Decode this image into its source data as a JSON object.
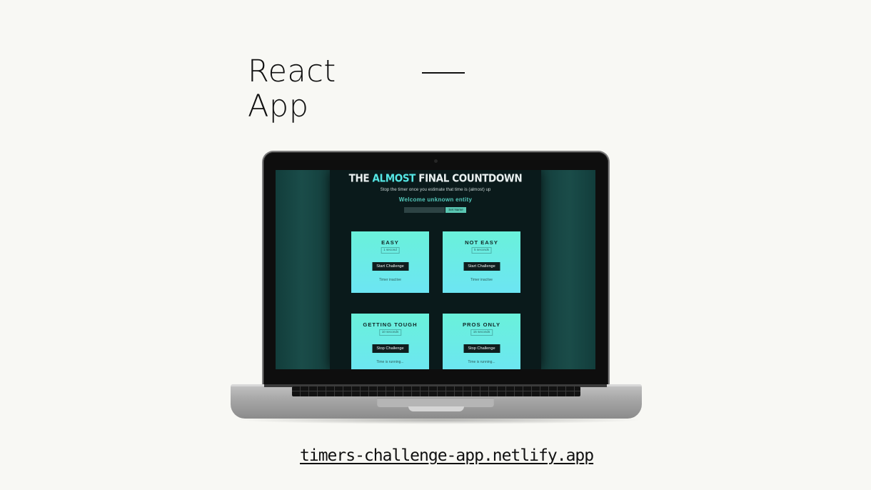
{
  "slide": {
    "title_line1": "React",
    "title_line2": "App",
    "url": "timers-challenge-app.netlify.app"
  },
  "app": {
    "title_prefix": "THE ",
    "title_highlight": "ALMOST",
    "title_suffix": " FINAL COUNTDOWN",
    "subtitle": "Stop the timer once you estimate that time is (almost) up",
    "welcome": "Welcome unknown entity",
    "name_input_value": "",
    "set_name_label": "Set Name",
    "cards": [
      {
        "title": "EASY",
        "time": "1 second",
        "button": "Start Challenge",
        "status": "Timer inactive"
      },
      {
        "title": "NOT EASY",
        "time": "5 seconds",
        "button": "Start Challenge",
        "status": "Timer inactive"
      },
      {
        "title": "GETTING TOUGH",
        "time": "10 seconds",
        "button": "Stop Challenge",
        "status": "Time is running..."
      },
      {
        "title": "PROS ONLY",
        "time": "15 seconds",
        "button": "Stop Challenge",
        "status": "Time is running..."
      }
    ]
  },
  "colors": {
    "page_bg": "#f8f8f4",
    "app_bg": "#0a1a1b",
    "highlight": "#54e6e4",
    "card_top": "#6af1da",
    "card_bottom": "#6ce5f3",
    "button_bg": "#0f1d1e",
    "set_name_bg": "#5ac7b3"
  }
}
